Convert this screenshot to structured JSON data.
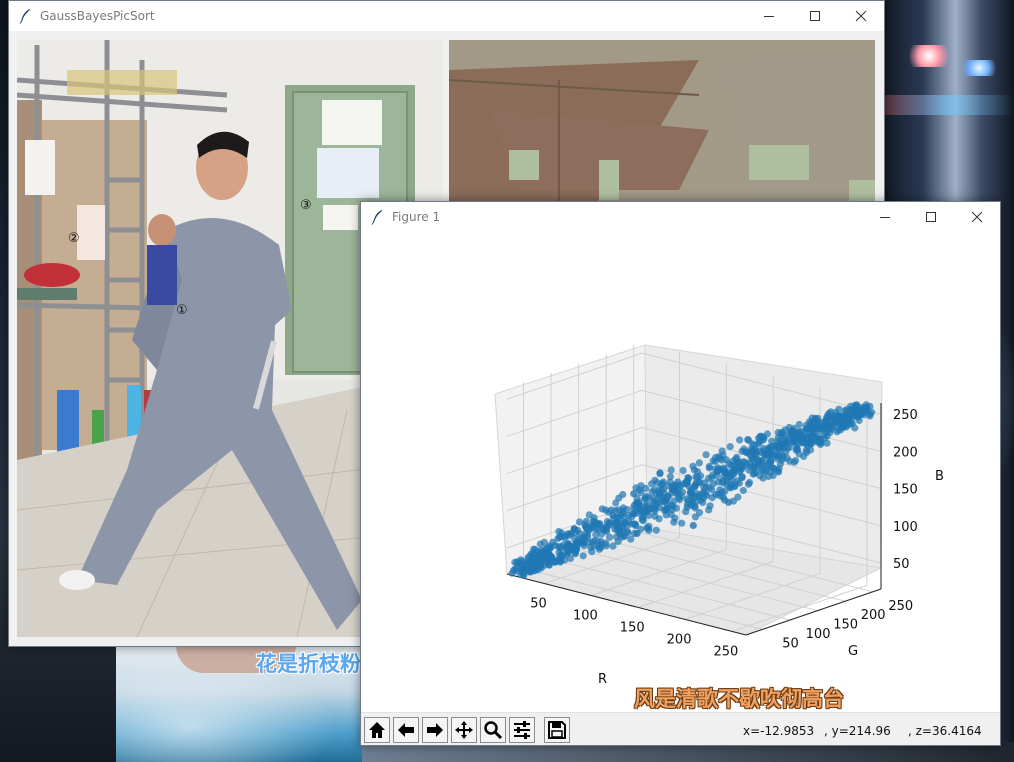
{
  "main_window": {
    "title": "GaussBayesPicSort",
    "markers": [
      "①",
      "②",
      "③"
    ]
  },
  "figure_window": {
    "title": "Figure 1",
    "status": {
      "x": "x=-12.9853",
      "y": ", y=214.96",
      "z": ", z=36.4164"
    },
    "toolbar": [
      "home-icon",
      "back-arrow-icon",
      "forward-arrow-icon",
      "pan-icon",
      "zoom-icon",
      "configure-subplots-icon",
      "save-icon"
    ]
  },
  "chart_data": {
    "type": "scatter",
    "projection": "3d",
    "xlabel": "R",
    "ylabel": "G",
    "zlabel": "B",
    "x_ticks": [
      50,
      100,
      150,
      200,
      250
    ],
    "y_ticks": [
      50,
      100,
      150,
      200,
      250
    ],
    "z_ticks": [
      50,
      100,
      150,
      200,
      250
    ],
    "xlim": [
      10,
      265
    ],
    "ylim": [
      20,
      265
    ],
    "zlim": [
      15,
      265
    ],
    "grid": true,
    "marker_color": "#1f77b4",
    "series": [
      {
        "points_sample": [
          [
            25,
            30,
            30
          ],
          [
            40,
            45,
            45
          ],
          [
            60,
            60,
            62
          ],
          [
            80,
            80,
            85
          ],
          [
            100,
            102,
            105
          ],
          [
            120,
            122,
            125
          ],
          [
            140,
            142,
            148
          ],
          [
            160,
            160,
            165
          ],
          [
            180,
            182,
            188
          ],
          [
            200,
            200,
            206
          ],
          [
            220,
            222,
            228
          ],
          [
            240,
            240,
            245
          ],
          [
            255,
            255,
            258
          ],
          [
            70,
            40,
            90
          ],
          [
            110,
            80,
            140
          ],
          [
            150,
            120,
            100
          ],
          [
            170,
            150,
            130
          ],
          [
            90,
            120,
            70
          ]
        ]
      }
    ]
  },
  "desktop": {
    "lyric_left": "花是折枝粉黛绕诗三百",
    "lyric_right": "风是清歌不歇吹彻高台"
  }
}
